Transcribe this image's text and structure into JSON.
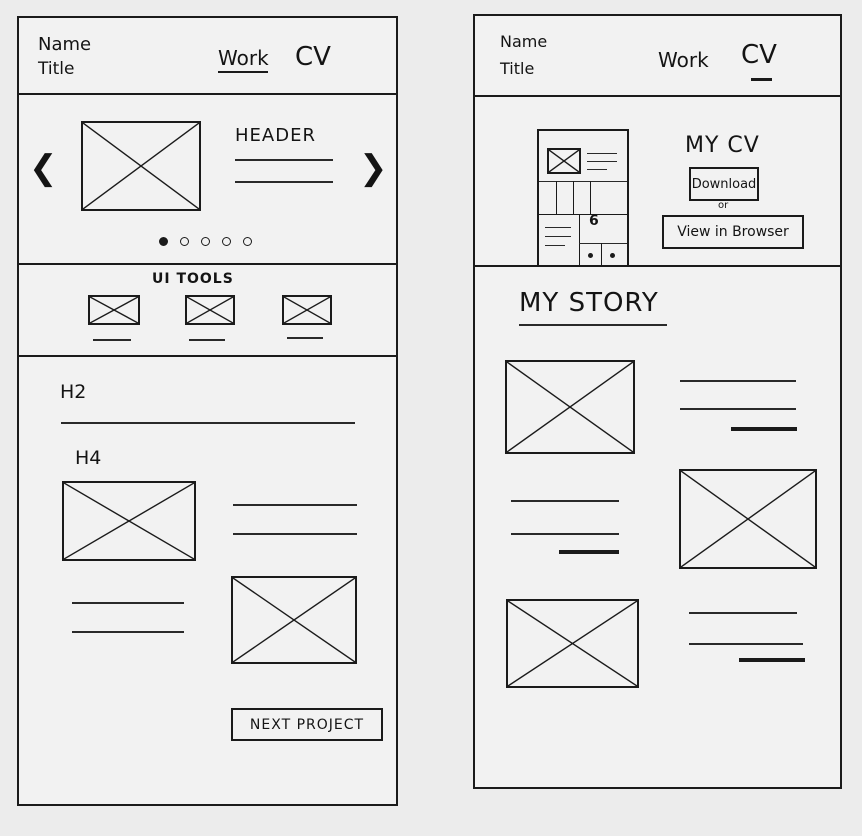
{
  "left": {
    "header": {
      "name": "Name",
      "title": "Title",
      "nav_work": "Work",
      "nav_cv": "CV"
    },
    "carousel": {
      "heading": "HEADER",
      "prev_glyph": "❮",
      "next_glyph": "❯",
      "dots_total": 5,
      "active_dot": 0
    },
    "tools": {
      "label": "UI TOOLS"
    },
    "project": {
      "h2": "H2",
      "h4": "H4",
      "next_button": "NEXT PROJECT"
    }
  },
  "right": {
    "header": {
      "name": "Name",
      "title": "Title",
      "nav_work": "Work",
      "nav_cv": "CV"
    },
    "cv": {
      "title": "MY CV",
      "download_button": "Download",
      "or_text": "or",
      "view_button": "View in Browser",
      "thumb_digit": "6"
    },
    "story": {
      "title": "MY STORY"
    }
  }
}
